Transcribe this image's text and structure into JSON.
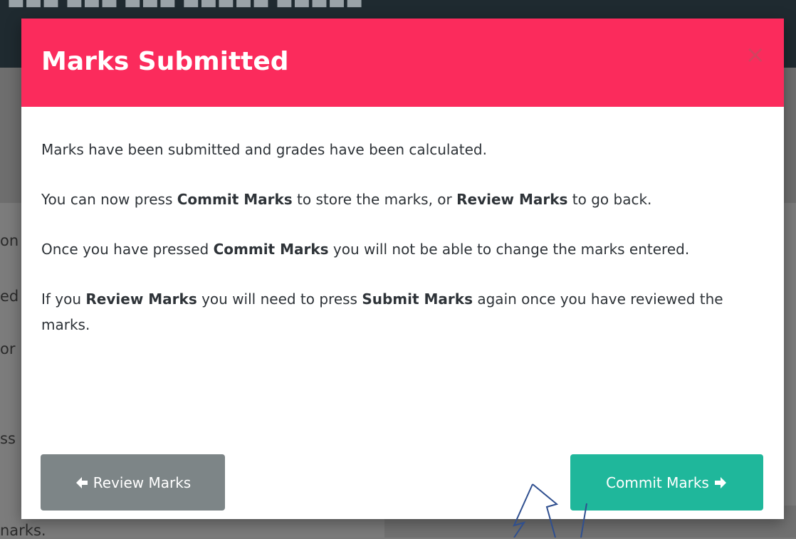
{
  "modal": {
    "title": "Marks Submitted",
    "close_symbol": "×",
    "paragraphs": [
      [
        {
          "text": "Marks have been submitted and grades have been calculated.",
          "bold": false
        }
      ],
      [
        {
          "text": "You can now press ",
          "bold": false
        },
        {
          "text": "Commit Marks",
          "bold": true
        },
        {
          "text": " to store the marks, or ",
          "bold": false
        },
        {
          "text": "Review Marks",
          "bold": true
        },
        {
          "text": " to go back.",
          "bold": false
        }
      ],
      [
        {
          "text": "Once you have pressed ",
          "bold": false
        },
        {
          "text": "Commit Marks",
          "bold": true
        },
        {
          "text": " you will not be able to change the marks entered.",
          "bold": false
        }
      ],
      [
        {
          "text": "If you ",
          "bold": false
        },
        {
          "text": "Review Marks",
          "bold": true
        },
        {
          "text": " you will need to press ",
          "bold": false
        },
        {
          "text": "Submit Marks",
          "bold": true
        },
        {
          "text": " again once you have reviewed the marks.",
          "bold": false
        }
      ]
    ],
    "buttons": {
      "review_label": "Review Marks",
      "commit_label": "Commit Marks"
    },
    "icons": {
      "review": "arrow-left-icon",
      "commit": "arrow-right-icon",
      "close": "close-icon"
    }
  },
  "background": {
    "fragments": [
      "on",
      "ed",
      "or",
      "ss",
      "narks."
    ]
  },
  "colors": {
    "header": "#fb2b5c",
    "commit_button": "#1fb79b",
    "review_button": "#7d8587",
    "pointer_stroke": "#2f4f8f"
  }
}
